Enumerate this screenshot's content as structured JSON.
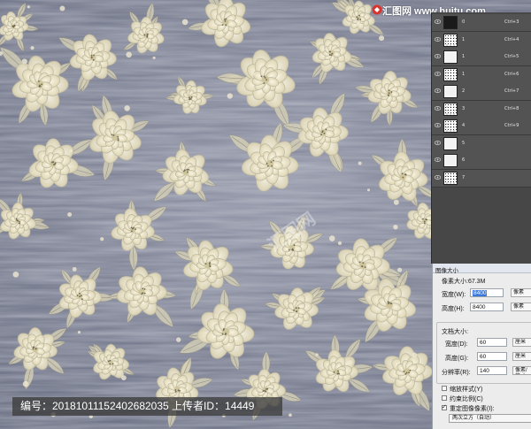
{
  "watermark": {
    "logo_text": "汇图网 www.huitu.com",
    "center_text": "汇图网",
    "id_line": "编号：20181011152402682035 上传者ID：14449"
  },
  "colors": {
    "background": "#6e7385",
    "petal": "#e8e0c4",
    "petal_shade": "#b9b49c",
    "leaf": "#d9d3ba",
    "panel": "#474747",
    "dialog": "#ececec",
    "selection": "#3c78d8"
  },
  "layers_panel": {
    "layers": [
      {
        "name": "0",
        "shortcut": "Ctrl+3",
        "thumb": "dark"
      },
      {
        "name": "1",
        "shortcut": "Ctrl+4",
        "thumb": "speckle"
      },
      {
        "name": "1",
        "shortcut": "Ctrl+5",
        "thumb": "soft"
      },
      {
        "name": "1",
        "shortcut": "Ctrl+6",
        "thumb": "speckle"
      },
      {
        "name": "2",
        "shortcut": "Ctrl+7",
        "thumb": "soft"
      },
      {
        "name": "3",
        "shortcut": "Ctrl+8",
        "thumb": "speckle"
      },
      {
        "name": "4",
        "shortcut": "Ctrl+9",
        "thumb": "speckle"
      },
      {
        "name": "5",
        "shortcut": "",
        "thumb": "soft"
      },
      {
        "name": "6",
        "shortcut": "",
        "thumb": "soft"
      },
      {
        "name": "7",
        "shortcut": "",
        "thumb": "speckle"
      }
    ]
  },
  "image_size_dialog": {
    "title": "图像大小",
    "pixel_dimensions": "像素大小:67.3M",
    "width_label": "宽度(W):",
    "width_value": "8400",
    "width_unit": "像素",
    "height_label": "高度(H):",
    "height_value": "8400",
    "height_unit": "像素",
    "document_size": "文档大小:",
    "doc_width_label": "宽度(D):",
    "doc_width_value": "60",
    "doc_width_unit": "厘米",
    "doc_height_label": "高度(G):",
    "doc_height_value": "60",
    "doc_height_unit": "厘米",
    "resolution_label": "分辨率(R):",
    "resolution_value": "140",
    "resolution_unit": "像素/英寸",
    "scale_styles": "缩放样式(Y)",
    "constrain_proportions": "约束比例(C)",
    "resample": "重定图像像素(I):",
    "resample_method": "两次立方（自动）",
    "scale_styles_checked": false,
    "constrain_checked": false,
    "resample_checked": true
  }
}
